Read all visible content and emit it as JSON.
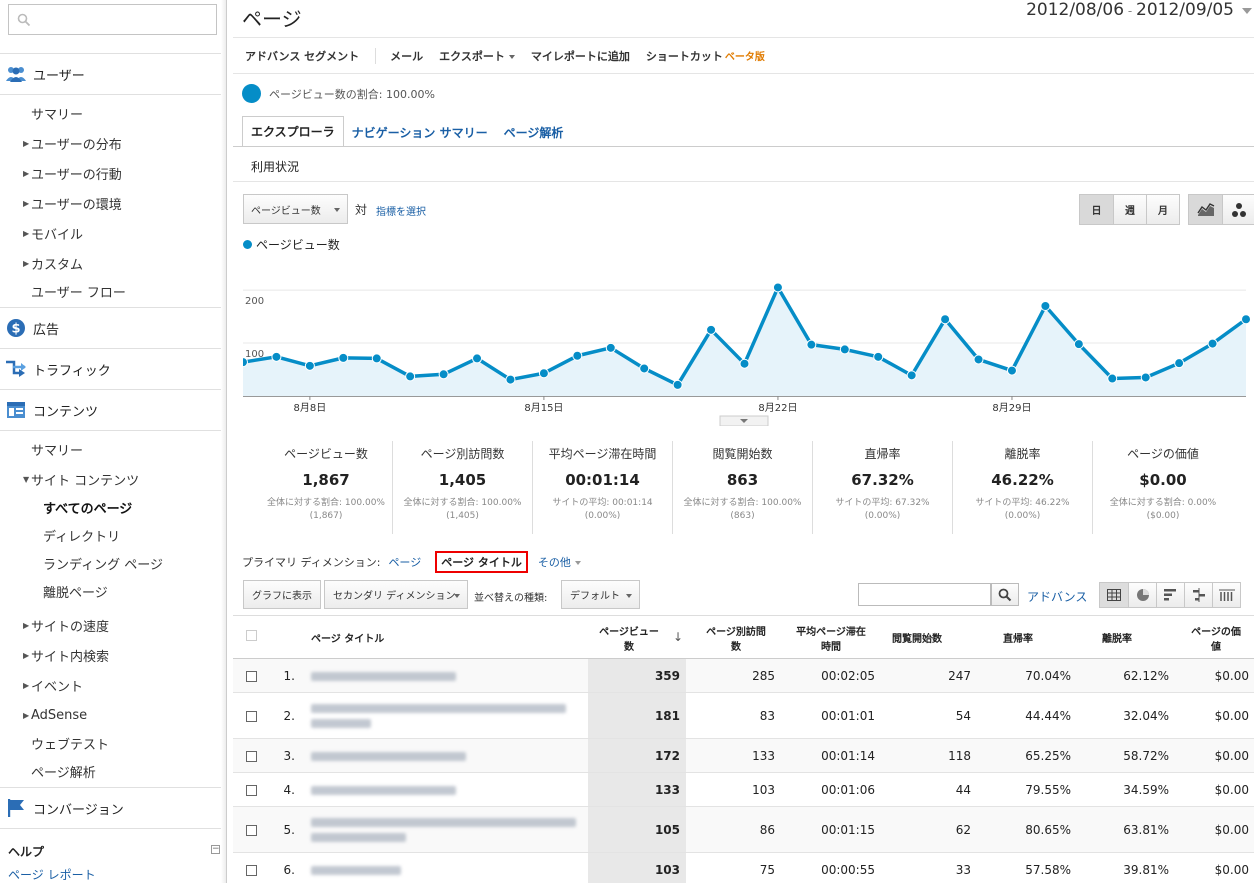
{
  "sidebar": {
    "search_placeholder": "",
    "sections": [
      {
        "label": "ユーザー",
        "icon": "users-icon"
      },
      {
        "label": "広告",
        "icon": "dollar-icon"
      },
      {
        "label": "トラフィック",
        "icon": "traffic-arrows-icon"
      },
      {
        "label": "コンテンツ",
        "icon": "content-icon"
      },
      {
        "label": "コンバージョン",
        "icon": "flag-icon"
      }
    ],
    "users_items": [
      "サマリー",
      "ユーザーの分布",
      "ユーザーの行動",
      "ユーザーの環境",
      "モバイル",
      "カスタム",
      "ユーザー フロー"
    ],
    "content_items": [
      "サマリー",
      "サイト コンテンツ",
      "すべてのページ",
      "ディレクトリ",
      "ランディング ページ",
      "離脱ページ",
      "サイトの速度",
      "サイト内検索",
      "イベント",
      "AdSense",
      "ウェブテスト",
      "ページ解析"
    ],
    "help_label": "ヘルプ",
    "help_toggle": "⊟",
    "help_link": "ページ レポート"
  },
  "header": {
    "title": "ページ",
    "date_start": "2012/08/06",
    "date_sep": " - ",
    "date_end": "2012/09/05"
  },
  "toolbar": {
    "advanced_segment": "アドバンス セグメント",
    "email": "メール",
    "export": "エクスポート",
    "add_to_dashboard": "マイレポートに追加",
    "shortcut": "ショートカット",
    "beta": "ベータ版"
  },
  "ratio_text": "ページビュー数の割合: 100.00%",
  "tabs": [
    "エクスプローラ",
    "ナビゲーション サマリー",
    "ページ解析"
  ],
  "subtab": "利用状況",
  "chart_controls": {
    "metric": "ページビュー数",
    "vs": "対",
    "choose_metric": "指標を選択",
    "day": "日",
    "week": "週",
    "month": "月"
  },
  "chart_data": {
    "type": "area",
    "series": [
      {
        "name": "ページビュー数",
        "values": [
          64,
          74,
          57,
          72,
          71,
          37,
          41,
          71,
          31,
          43,
          76,
          91,
          52,
          21,
          125,
          61,
          205,
          97,
          88,
          74,
          39,
          145,
          69,
          48,
          170,
          98,
          33,
          35,
          62,
          99,
          145
        ]
      }
    ],
    "x_ticks": [
      {
        "index": 2,
        "label": "8月8日"
      },
      {
        "index": 9,
        "label": "8月15日"
      },
      {
        "index": 16,
        "label": "8月22日"
      },
      {
        "index": 23,
        "label": "8月29日"
      }
    ],
    "y_ticks": [
      100,
      200
    ],
    "ylim": [
      0,
      255
    ],
    "color": "#058dc7",
    "fill": "#e6f3fa"
  },
  "scorecards": [
    {
      "label": "ページビュー数",
      "value": "1,867",
      "sub1": "全体に対する割合: 100.00%",
      "sub2": "(1,867)"
    },
    {
      "label": "ページ別訪問数",
      "value": "1,405",
      "sub1": "全体に対する割合: 100.00%",
      "sub2": "(1,405)"
    },
    {
      "label": "平均ページ滞在時間",
      "value": "00:01:14",
      "sub1": "サイトの平均: 00:01:14",
      "sub2": "(0.00%)"
    },
    {
      "label": "閲覧開始数",
      "value": "863",
      "sub1": "全体に対する割合: 100.00%",
      "sub2": "(863)"
    },
    {
      "label": "直帰率",
      "value": "67.32%",
      "sub1": "サイトの平均: 67.32%",
      "sub2": "(0.00%)"
    },
    {
      "label": "離脱率",
      "value": "46.22%",
      "sub1": "サイトの平均: 46.22%",
      "sub2": "(0.00%)"
    },
    {
      "label": "ページの価値",
      "value": "$0.00",
      "sub1": "全体に対する割合: 0.00%",
      "sub2": "($0.00)"
    }
  ],
  "dimension": {
    "label": "プライマリ ディメンション:",
    "page": "ページ",
    "page_title": "ページ タイトル",
    "other": "その他"
  },
  "table_toolbar": {
    "plot": "グラフに表示",
    "secondary": "セカンダリ ディメンション",
    "sort_label": "並べ替えの種類:",
    "sort_value": "デフォルト",
    "advanced": "アドバンス"
  },
  "columns": {
    "title": "ページ タイトル",
    "pv1": "ページビュー",
    "pv2": "数",
    "uv1": "ページ別訪問",
    "uv2": "数",
    "time1": "平均ページ滞在",
    "time2": "時間",
    "entr": "閲覧開始数",
    "bounce": "直帰率",
    "exit": "離脱率",
    "value1": "ページの価",
    "value2": "値"
  },
  "rows": [
    {
      "idx": "1.",
      "pv": "359",
      "uv": "285",
      "time": "00:02:05",
      "entr": "247",
      "bounce": "70.04%",
      "exit": "62.12%",
      "value": "$0.00"
    },
    {
      "idx": "2.",
      "pv": "181",
      "uv": "83",
      "time": "00:01:01",
      "entr": "54",
      "bounce": "44.44%",
      "exit": "32.04%",
      "value": "$0.00"
    },
    {
      "idx": "3.",
      "pv": "172",
      "uv": "133",
      "time": "00:01:14",
      "entr": "118",
      "bounce": "65.25%",
      "exit": "58.72%",
      "value": "$0.00"
    },
    {
      "idx": "4.",
      "pv": "133",
      "uv": "103",
      "time": "00:01:06",
      "entr": "44",
      "bounce": "79.55%",
      "exit": "34.59%",
      "value": "$0.00"
    },
    {
      "idx": "5.",
      "pv": "105",
      "uv": "86",
      "time": "00:01:15",
      "entr": "62",
      "bounce": "80.65%",
      "exit": "63.81%",
      "value": "$0.00"
    },
    {
      "idx": "6.",
      "pv": "103",
      "uv": "75",
      "time": "00:00:55",
      "entr": "33",
      "bounce": "57.58%",
      "exit": "39.81%",
      "value": "$0.00"
    }
  ]
}
